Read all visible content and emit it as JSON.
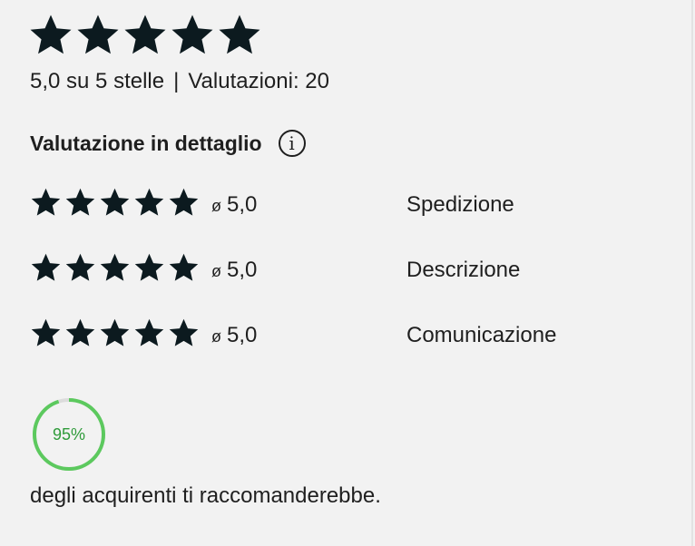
{
  "overall": {
    "stars": 5,
    "summary_score": "5,0 su 5 stelle",
    "separator": "|",
    "summary_count": "Valutazioni: 20"
  },
  "detail": {
    "title": "Valutazione in dettaglio",
    "info_glyph": "i",
    "rows": [
      {
        "stars": 5,
        "avg_symbol": "ø",
        "avg_value": "5,0",
        "label": "Spedizione"
      },
      {
        "stars": 5,
        "avg_symbol": "ø",
        "avg_value": "5,0",
        "label": "Descrizione"
      },
      {
        "stars": 5,
        "avg_symbol": "ø",
        "avg_value": "5,0",
        "label": "Comunicazione"
      }
    ]
  },
  "recommendation": {
    "percent": 95,
    "percent_label": "95%",
    "text": "degli acquirenti ti raccomanderebbe.",
    "ring_color": "#5cc95e",
    "ring_track_color": "#dcdcdc"
  },
  "colors": {
    "star": "#0c1a1f",
    "text": "#1f1f1f",
    "background": "#f2f2f2"
  }
}
